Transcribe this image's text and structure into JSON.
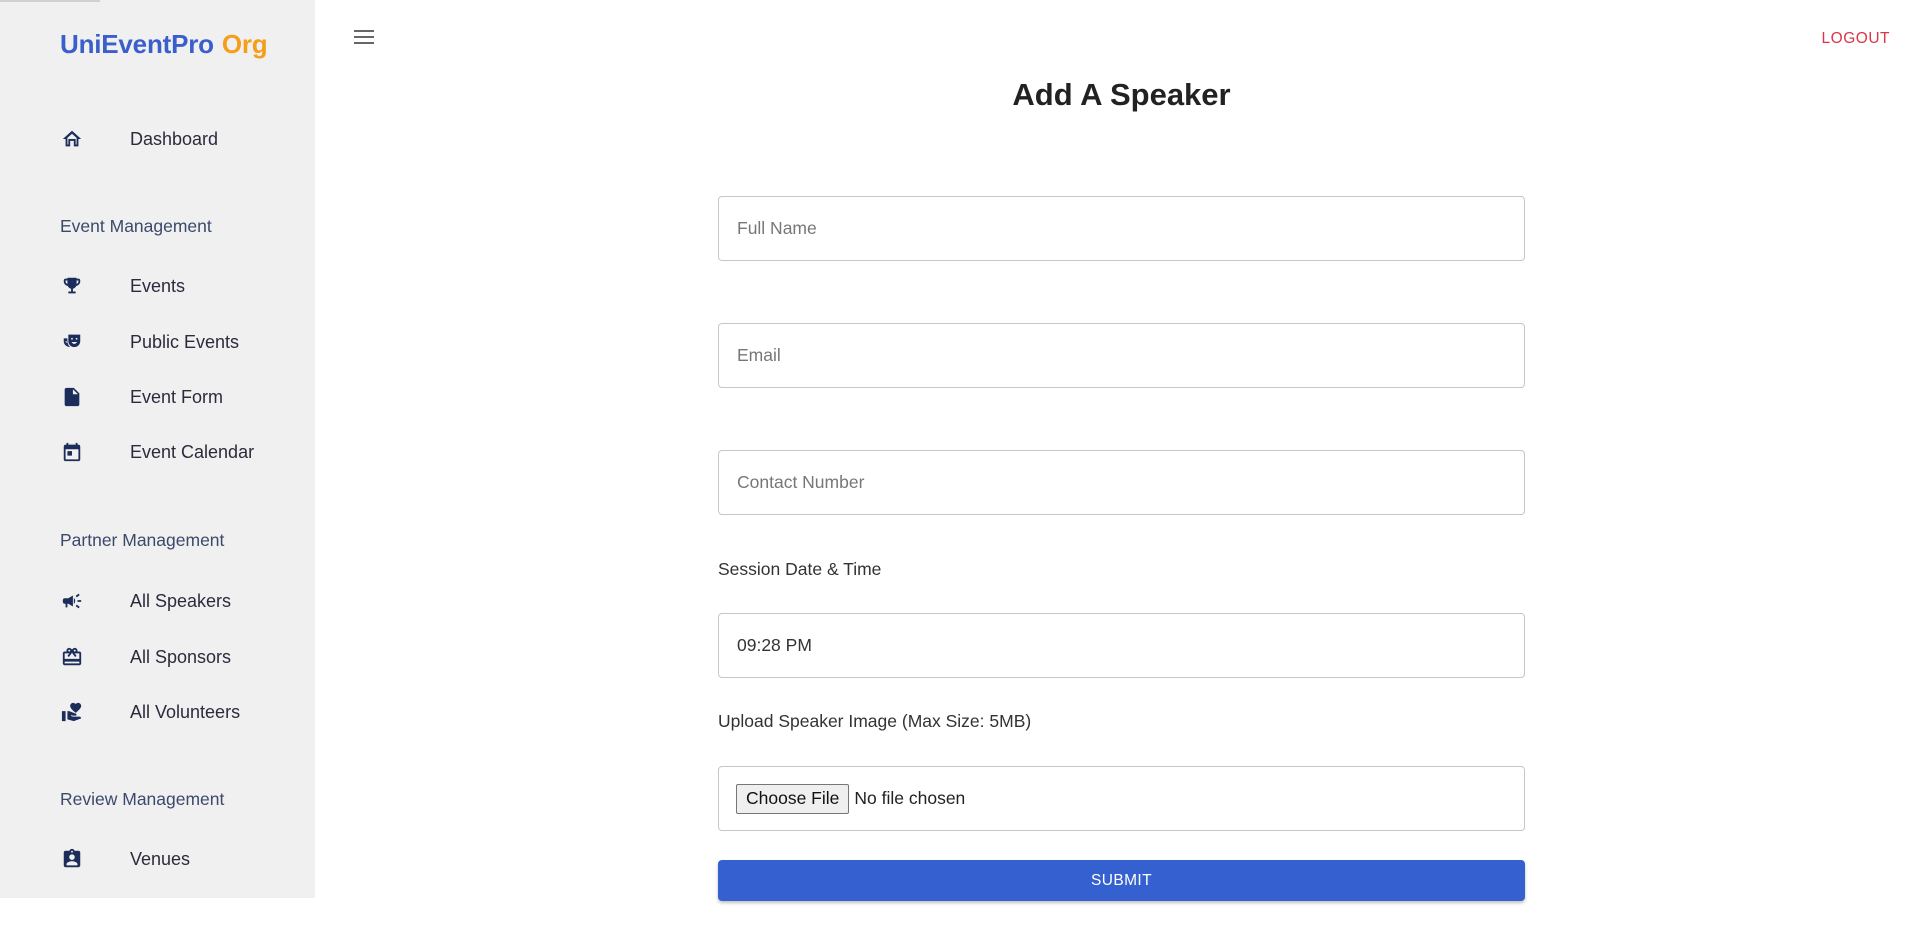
{
  "brand": {
    "name_primary": "UniEventPro",
    "name_secondary": "Org"
  },
  "header": {
    "logout_label": "LOGOUT"
  },
  "sidebar": {
    "dashboard": "Dashboard",
    "event_section": "Event Management",
    "events": "Events",
    "public_events": "Public Events",
    "event_form": "Event Form",
    "event_calendar": "Event Calendar",
    "partner_section": "Partner Management",
    "all_speakers": "All Speakers",
    "all_sponsors": "All Sponsors",
    "all_volunteers": "All Volunteers",
    "review_section": "Review Management",
    "venues": "Venues"
  },
  "form": {
    "title": "Add A Speaker",
    "full_name_placeholder": "Full Name",
    "email_placeholder": "Email",
    "contact_placeholder": "Contact Number",
    "session_label": "Session Date & Time",
    "session_value": "09:28 PM",
    "upload_label": "Upload Speaker Image (Max Size: 5MB)",
    "choose_file_label": "Choose File",
    "file_status": "No file chosen",
    "submit_label": "SUBMIT"
  },
  "colors": {
    "brand_primary": "#3a5fcd",
    "brand_secondary": "#f59e1b",
    "logout": "#d9364a",
    "submit": "#3560d0",
    "sidebar_bg": "#f0f0f0",
    "icon": "#1c2d5a"
  }
}
